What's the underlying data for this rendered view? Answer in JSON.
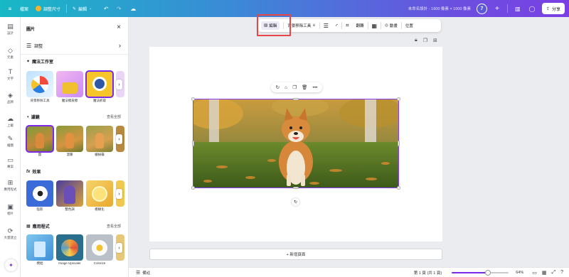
{
  "topbar": {
    "file": "檔案",
    "resize": "調整尺寸",
    "editing": "編輯",
    "doc_title": "未命名設計 - 1600 像素 × 1000 像素",
    "avatar_number": "7",
    "share": "分享"
  },
  "rail": [
    {
      "icon": "grid-icon",
      "label": "設計"
    },
    {
      "icon": "elements-icon",
      "label": "元素"
    },
    {
      "icon": "text-icon",
      "label": "文字"
    },
    {
      "icon": "brand-icon",
      "label": "品牌"
    },
    {
      "icon": "upload-icon",
      "label": "上載"
    },
    {
      "icon": "draw-icon",
      "label": "繪圖"
    },
    {
      "icon": "projects-icon",
      "label": "專案"
    },
    {
      "icon": "apps-icon",
      "label": "應用程式"
    },
    {
      "icon": "photos-icon",
      "label": "相片"
    },
    {
      "icon": "magic-media-icon",
      "label": "大量建立"
    }
  ],
  "panel": {
    "title": "圖片",
    "adjust_label": "調整",
    "magic_studio_title": "魔法工作室",
    "magic_tools": [
      {
        "label": "背景移除工具"
      },
      {
        "label": "魔法擦皮擦"
      },
      {
        "label": "魔法抓取"
      }
    ],
    "filters_title": "濾鏡",
    "filters_more": "查看全部",
    "filters": [
      {
        "label": "無"
      },
      {
        "label": "溫暖"
      },
      {
        "label": "繽紛霧"
      }
    ],
    "effects_title": "效果",
    "effects": [
      {
        "label": "陰影"
      },
      {
        "label": "雙色調"
      },
      {
        "label": "模糊化"
      }
    ],
    "apps_title": "應用程式",
    "apps_more": "查看全部",
    "apps": [
      {
        "label": "樸拙"
      },
      {
        "label": "Image Upscaler"
      },
      {
        "label": "Colorize"
      }
    ]
  },
  "context_toolbar": {
    "edit": "編輯",
    "bg_remover": "背景移除工具",
    "flip": "翻轉",
    "animate": "動畫",
    "position": "位置"
  },
  "canvas": {
    "add_page": "+ 新增頁面"
  },
  "bottombar": {
    "notes": "備註",
    "page_indicator": "第 1 頁 (共 1 頁)",
    "zoom": "64%",
    "zoom_fraction": 0.64
  }
}
